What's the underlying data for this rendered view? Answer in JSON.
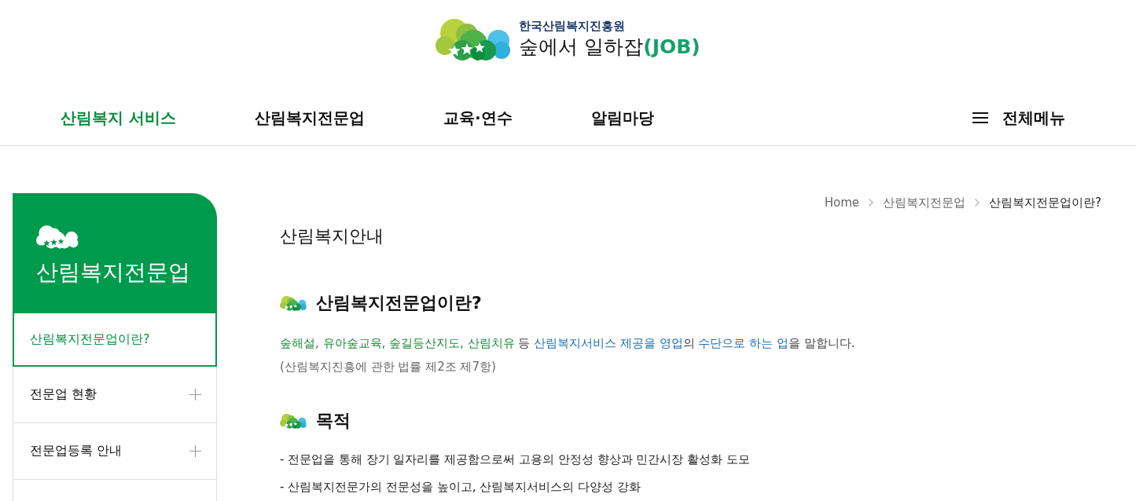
{
  "header": {
    "org_name": "한국산림복지진흥원",
    "site_name": "숲에서 일하잡**(JOB)**"
  },
  "nav": {
    "items": [
      {
        "label": "산림복지 서비스",
        "selected": true
      },
      {
        "label": "산림복지전문업",
        "selected": false
      },
      {
        "label": "교육·연수",
        "selected": false
      },
      {
        "label": "알림마당",
        "selected": false
      }
    ],
    "all_menu": "전체메뉴"
  },
  "sidebar": {
    "title": "산림복지전문업",
    "items": [
      {
        "label": "산림복지전문업이란?",
        "selected": true,
        "expandable": false
      },
      {
        "label": "전문업 현황",
        "selected": false,
        "expandable": true
      },
      {
        "label": "전문업등록 안내",
        "selected": false,
        "expandable": true
      }
    ]
  },
  "breadcrumb": [
    {
      "label": "Home",
      "current": false
    },
    {
      "label": "산림복지전문업",
      "current": false
    },
    {
      "label": "산림복지전문업이란?",
      "current": true
    }
  ],
  "page_title": "산림복지안내",
  "sections": [
    {
      "kind": "definition",
      "heading": "산림복지전문업이란?",
      "parts": [
        {
          "text": "숲해설, 유아숲교육, 숲길등산지도, 산림치유",
          "kind": "term"
        },
        {
          "text": " 등 ",
          "kind": "plain"
        },
        {
          "text": "산림복지서비스 제공을 영업",
          "kind": "definition"
        },
        {
          "text": "의 ",
          "kind": "plain"
        },
        {
          "text": "수단으로 하는 업",
          "kind": "definition"
        },
        {
          "text": "을 말합니다.",
          "kind": "plain"
        }
      ],
      "note": "(산림복지진흥에 관한 법률 제2조 제7항)"
    },
    {
      "kind": "list",
      "heading": "목적",
      "items": [
        "- 전문업을 통해 장기 일자리를 제공함으로써 고용의 안정성 향상과 민간시장 활성화 도모",
        "- 산림복지전문가의 전문성을 높이고, 산림복지서비스의 다양성 강화"
      ]
    }
  ]
}
